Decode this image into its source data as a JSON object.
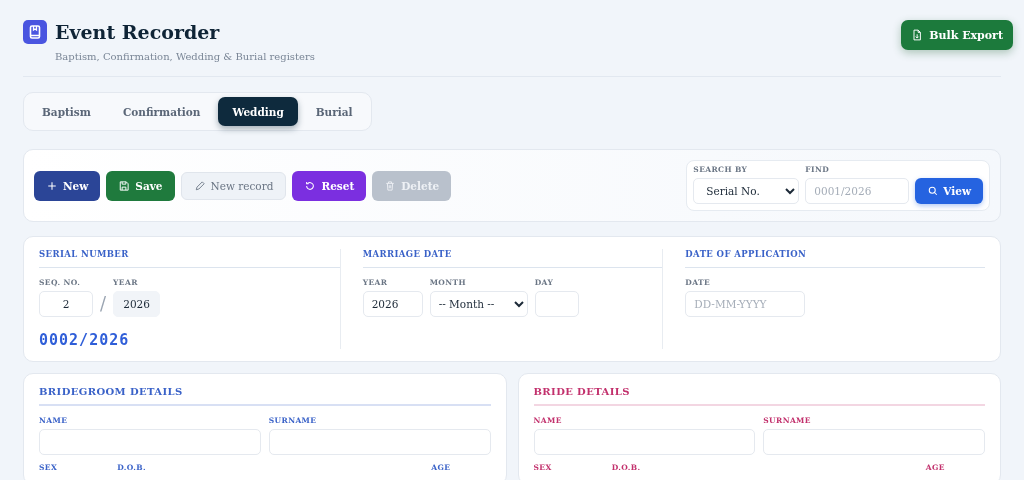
{
  "header": {
    "title": "Event Recorder",
    "subtitle": "Baptism, Confirmation, Wedding & Burial registers",
    "export_button": "Bulk Export"
  },
  "tabs": [
    {
      "label": "Baptism",
      "selected": false
    },
    {
      "label": "Confirmation",
      "selected": false
    },
    {
      "label": "Wedding",
      "selected": true
    },
    {
      "label": "Burial",
      "selected": false
    }
  ],
  "actions": [
    {
      "label": "New",
      "kind": "new",
      "disabled": false
    },
    {
      "label": "Save",
      "kind": "save",
      "disabled": false
    },
    {
      "label": "New record",
      "kind": "edit",
      "disabled": false
    },
    {
      "label": "Reset",
      "kind": "reset",
      "disabled": false
    },
    {
      "label": "Delete",
      "kind": "delete",
      "disabled": true
    }
  ],
  "search": {
    "search_by_label": "SEARCH BY",
    "search_by_value": "Serial No.",
    "find_label": "FIND",
    "find_placeholder": "0001/2026",
    "view_button": "View"
  },
  "serial": {
    "heading": "SERIAL NUMBER",
    "seq_label": "SEQ. NO.",
    "seq_value": "2",
    "separator": "/",
    "year_label": "YEAR",
    "year_value": "2026",
    "formatted": "0002/2026"
  },
  "marriage_date": {
    "heading": "MARRIAGE DATE",
    "year_label": "YEAR",
    "year_value": "2026",
    "month_label": "MONTH",
    "month_value": "-- Month --",
    "day_label": "DAY"
  },
  "application": {
    "heading": "DATE OF APPLICATION",
    "date_label": "DATE",
    "date_placeholder": "DD-MM-YYYY"
  },
  "parties": [
    {
      "heading": "BRIDEGROOM DETAILS",
      "color": "#3a62c8",
      "name_label": "NAME",
      "surname_label": "SURNAME",
      "sex_label": "SEX",
      "dob_label": "D.O.B.",
      "age_label": "AGE"
    },
    {
      "heading": "BRIDE DETAILS",
      "color": "#c2306c",
      "name_label": "NAME",
      "surname_label": "SURNAME",
      "sex_label": "SEX",
      "dob_label": "D.O.B.",
      "age_label": "AGE"
    }
  ]
}
